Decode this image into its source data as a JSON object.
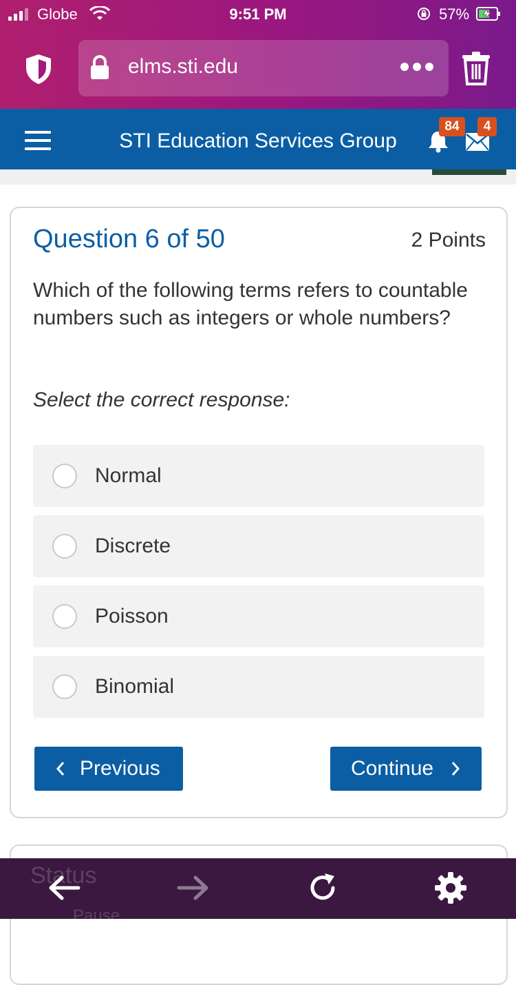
{
  "status_bar": {
    "carrier": "Globe",
    "time": "9:51 PM",
    "battery_percent": "57%"
  },
  "browser": {
    "url": "elms.sti.edu",
    "icons": [
      "shield-icon",
      "lock-icon",
      "more-icon",
      "trash-icon"
    ]
  },
  "site_header": {
    "title": "STI Education Services Group",
    "notifications_count": "84",
    "messages_count": "4"
  },
  "question": {
    "title": "Question 6 of 50",
    "points": "2 Points",
    "text": "Which of the following terms refers to countable numbers such as integers or whole numbers?",
    "instruction": "Select the correct response:",
    "options": [
      {
        "label": "Normal",
        "selected": false
      },
      {
        "label": "Discrete",
        "selected": false
      },
      {
        "label": "Poisson",
        "selected": false
      },
      {
        "label": "Binomial",
        "selected": false
      }
    ]
  },
  "navigation": {
    "previous_label": "Previous",
    "continue_label": "Continue"
  },
  "background_content": {
    "status_label": "Status",
    "pause_label": "Pause"
  },
  "toolbar": {
    "icons": [
      "back-arrow-icon",
      "forward-arrow-icon",
      "reload-icon",
      "settings-icon"
    ]
  },
  "colors": {
    "browser_gradient": "#b01f6e",
    "header_blue": "#0b5ea4",
    "badge_orange": "#d9501e",
    "toolbar": "#3b1840"
  }
}
